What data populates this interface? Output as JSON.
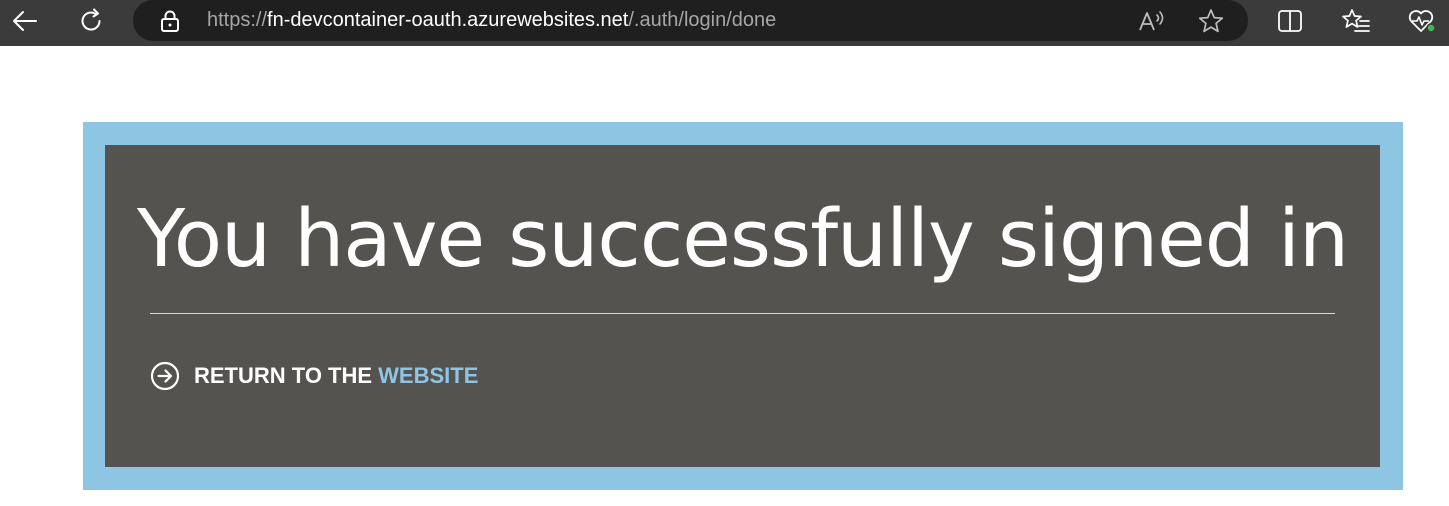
{
  "browser": {
    "url_scheme": "https://",
    "url_host": "fn-devcontainer-oauth.azurewebsites.net",
    "url_path": "/.auth/login/done",
    "icons": {
      "back": "back-arrow-icon",
      "refresh": "refresh-icon",
      "lock": "lock-icon",
      "read_aloud": "read-aloud-icon",
      "favorite": "star-icon",
      "split_screen": "split-screen-icon",
      "favorites": "favorites-list-icon",
      "health": "browser-essentials-icon"
    },
    "colors": {
      "toolbar": "#3b3b3b",
      "addressbar": "#1f1f1f",
      "status_dot": "#3fb950"
    }
  },
  "page": {
    "headline": "You have successfully signed in",
    "return_prefix": "RETURN TO THE",
    "return_link": "WEBSITE",
    "icons": {
      "return": "arrow-circle-right-icon"
    },
    "colors": {
      "frame": "#8dc5e3",
      "panel": "#55534f",
      "accent": "#8dc5e3"
    }
  }
}
